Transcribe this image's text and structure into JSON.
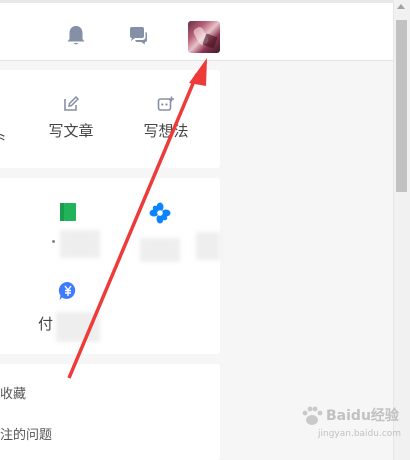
{
  "write": {
    "article_label": "写文章",
    "idea_label": "写想法",
    "edge_glyph": "⺀"
  },
  "apps": {
    "partial_label": "付"
  },
  "links": {
    "favorites": "收藏",
    "following_questions": "注的问题"
  },
  "watermark": {
    "text": "Baidu经验",
    "sub": "jingyan.baidu.com"
  },
  "icons": {
    "topbar": [
      "bell-icon",
      "chat-bubbles-icon",
      "avatar"
    ],
    "write": [
      "edit-pencil-icon",
      "idea-plus-icon"
    ],
    "apps": [
      "book-icon",
      "flower-icon",
      "yuan-coin-icon"
    ]
  },
  "colors": {
    "green": "#21b35a",
    "blue": "#0a84ff",
    "coin_blue": "#3e7bff",
    "arrow_red": "#ef3a3a",
    "icon_gray": "#8590a6"
  }
}
